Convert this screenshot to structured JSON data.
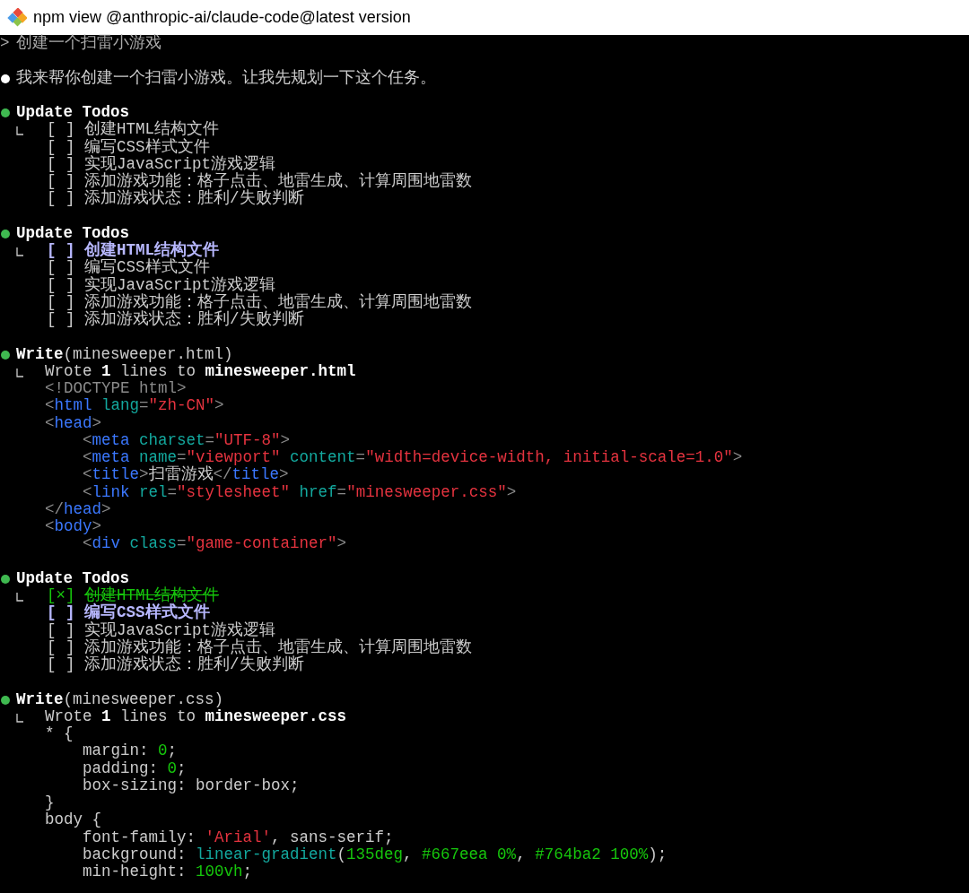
{
  "window": {
    "title": "npm view @anthropic-ai/claude-code@latest version"
  },
  "transcript": [
    {
      "kind": "prompt",
      "marker": ">",
      "text": "创建一个扫雷小游戏"
    },
    {
      "kind": "message",
      "color": "#ffffff",
      "text": "我来帮你创建一个扫雷小游戏。让我先规划一下这个任务。"
    },
    {
      "kind": "todos",
      "color": "#3fb950",
      "title": "Update Todos",
      "items": [
        {
          "box": "[ ]",
          "text": "创建HTML结构文件",
          "checked": false,
          "active": false
        },
        {
          "box": "[ ]",
          "text": "编写CSS样式文件",
          "checked": false,
          "active": false
        },
        {
          "box": "[ ]",
          "text": "实现JavaScript游戏逻辑",
          "checked": false,
          "active": false
        },
        {
          "box": "[ ]",
          "text": "添加游戏功能：格子点击、地雷生成、计算周围地雷数",
          "checked": false,
          "active": false
        },
        {
          "box": "[ ]",
          "text": "添加游戏状态：胜利/失败判断",
          "checked": false,
          "active": false
        }
      ]
    },
    {
      "kind": "todos",
      "color": "#3fb950",
      "title": "Update Todos",
      "items": [
        {
          "box": "[ ]",
          "text": "创建HTML结构文件",
          "checked": false,
          "active": true
        },
        {
          "box": "[ ]",
          "text": "编写CSS样式文件",
          "checked": false,
          "active": false
        },
        {
          "box": "[ ]",
          "text": "实现JavaScript游戏逻辑",
          "checked": false,
          "active": false
        },
        {
          "box": "[ ]",
          "text": "添加游戏功能：格子点击、地雷生成、计算周围地雷数",
          "checked": false,
          "active": false
        },
        {
          "box": "[ ]",
          "text": "添加游戏状态：胜利/失败判断",
          "checked": false,
          "active": false
        }
      ]
    },
    {
      "kind": "tool",
      "color": "#3fb950",
      "header": "**Write**(minesweeper.html)",
      "result": "Wrote **1** lines to **minesweeper.html**",
      "code": [
        {
          "tokens": [
            {
              "kind": "doctype",
              "text": "<!DOCTYPE html>"
            }
          ]
        },
        {
          "tokens": [
            {
              "kind": "punct",
              "text": "<"
            },
            {
              "kind": "tag",
              "text": "html"
            },
            {
              "kind": "attr",
              "text": " lang"
            },
            {
              "kind": "punct",
              "text": "="
            },
            {
              "kind": "string",
              "text": "\"zh-CN\""
            },
            {
              "kind": "punct",
              "text": ">"
            }
          ]
        },
        {
          "tokens": [
            {
              "kind": "punct",
              "text": "<"
            },
            {
              "kind": "tag",
              "text": "head"
            },
            {
              "kind": "punct",
              "text": ">"
            }
          ],
          "children": [
            {
              "tokens": [
                {
                  "kind": "punct",
                  "text": "<"
                },
                {
                  "kind": "tag",
                  "text": "meta"
                },
                {
                  "kind": "attr",
                  "text": " charset"
                },
                {
                  "kind": "punct",
                  "text": "="
                },
                {
                  "kind": "string",
                  "text": "\"UTF-8\""
                },
                {
                  "kind": "punct",
                  "text": ">"
                }
              ]
            },
            {
              "tokens": [
                {
                  "kind": "punct",
                  "text": "<"
                },
                {
                  "kind": "tag",
                  "text": "meta"
                },
                {
                  "kind": "attr",
                  "text": " name"
                },
                {
                  "kind": "punct",
                  "text": "="
                },
                {
                  "kind": "string",
                  "text": "\"viewport\""
                },
                {
                  "kind": "attr",
                  "text": " content"
                },
                {
                  "kind": "punct",
                  "text": "="
                },
                {
                  "kind": "string",
                  "text": "\"width=device-width, initial-scale=1.0\""
                },
                {
                  "kind": "punct",
                  "text": ">"
                }
              ]
            },
            {
              "tokens": [
                {
                  "kind": "punct",
                  "text": "<"
                },
                {
                  "kind": "tag",
                  "text": "title"
                },
                {
                  "kind": "punct",
                  "text": ">"
                },
                {
                  "kind": "plain",
                  "text": "扫雷游戏"
                },
                {
                  "kind": "punct",
                  "text": "</"
                },
                {
                  "kind": "tag",
                  "text": "title"
                },
                {
                  "kind": "punct",
                  "text": ">"
                }
              ]
            },
            {
              "tokens": [
                {
                  "kind": "punct",
                  "text": "<"
                },
                {
                  "kind": "tag",
                  "text": "link"
                },
                {
                  "kind": "attr",
                  "text": " rel"
                },
                {
                  "kind": "punct",
                  "text": "="
                },
                {
                  "kind": "string",
                  "text": "\"stylesheet\""
                },
                {
                  "kind": "attr",
                  "text": " href"
                },
                {
                  "kind": "punct",
                  "text": "="
                },
                {
                  "kind": "string",
                  "text": "\"minesweeper.css\""
                },
                {
                  "kind": "punct",
                  "text": ">"
                }
              ]
            }
          ]
        },
        {
          "tokens": [
            {
              "kind": "punct",
              "text": "</"
            },
            {
              "kind": "tag",
              "text": "head"
            },
            {
              "kind": "punct",
              "text": ">"
            }
          ]
        },
        {
          "tokens": [
            {
              "kind": "punct",
              "text": "<"
            },
            {
              "kind": "tag",
              "text": "body"
            },
            {
              "kind": "punct",
              "text": ">"
            }
          ],
          "children": [
            {
              "tokens": [
                {
                  "kind": "punct",
                  "text": "<"
                },
                {
                  "kind": "tag",
                  "text": "div"
                },
                {
                  "kind": "attr",
                  "text": " class"
                },
                {
                  "kind": "punct",
                  "text": "="
                },
                {
                  "kind": "string",
                  "text": "\"game-container\""
                },
                {
                  "kind": "punct",
                  "text": ">"
                }
              ]
            }
          ]
        }
      ]
    },
    {
      "kind": "todos",
      "color": "#3fb950",
      "title": "Update Todos",
      "items": [
        {
          "box": "[×]",
          "text": "创建HTML结构文件",
          "checked": true,
          "active": false
        },
        {
          "box": "[ ]",
          "text": "编写CSS样式文件",
          "checked": false,
          "active": true
        },
        {
          "box": "[ ]",
          "text": "实现JavaScript游戏逻辑",
          "checked": false,
          "active": false
        },
        {
          "box": "[ ]",
          "text": "添加游戏功能：格子点击、地雷生成、计算周围地雷数",
          "checked": false,
          "active": false
        },
        {
          "box": "[ ]",
          "text": "添加游戏状态：胜利/失败判断",
          "checked": false,
          "active": false
        }
      ]
    },
    {
      "kind": "tool",
      "color": "#3fb950",
      "header": "**Write**(minesweeper.css)",
      "result": "Wrote **1** lines to **minesweeper.css**",
      "code": [
        {
          "tokens": [
            {
              "kind": "plain",
              "text": "* {"
            }
          ],
          "children": [
            {
              "tokens": [
                {
                  "kind": "plain",
                  "text": "margin: "
                },
                {
                  "kind": "number",
                  "text": "0"
                },
                {
                  "kind": "plain",
                  "text": ";"
                }
              ]
            },
            {
              "tokens": [
                {
                  "kind": "plain",
                  "text": "padding: "
                },
                {
                  "kind": "number",
                  "text": "0"
                },
                {
                  "kind": "plain",
                  "text": ";"
                }
              ]
            },
            {
              "tokens": [
                {
                  "kind": "plain",
                  "text": "box-sizing: border-box;"
                }
              ]
            }
          ]
        },
        {
          "tokens": [
            {
              "kind": "plain",
              "text": "}"
            }
          ]
        },
        {
          "tokens": [
            {
              "kind": "plain",
              "text": "body {"
            }
          ],
          "children": [
            {
              "tokens": [
                {
                  "kind": "plain",
                  "text": "font-family: "
                },
                {
                  "kind": "string",
                  "text": "'Arial'"
                },
                {
                  "kind": "plain",
                  "text": ", sans-serif;"
                }
              ]
            },
            {
              "tokens": [
                {
                  "kind": "plain",
                  "text": "background: "
                },
                {
                  "kind": "func",
                  "text": "linear-gradient"
                },
                {
                  "kind": "plain",
                  "text": "("
                },
                {
                  "kind": "number",
                  "text": "135deg"
                },
                {
                  "kind": "plain",
                  "text": ", "
                },
                {
                  "kind": "number",
                  "text": "#667eea 0%"
                },
                {
                  "kind": "plain",
                  "text": ", "
                },
                {
                  "kind": "number",
                  "text": "#764ba2 100%"
                },
                {
                  "kind": "plain",
                  "text": ");"
                }
              ]
            },
            {
              "tokens": [
                {
                  "kind": "plain",
                  "text": "min-height: "
                },
                {
                  "kind": "number",
                  "text": "100vh"
                },
                {
                  "kind": "plain",
                  "text": ";"
                }
              ]
            }
          ]
        }
      ]
    }
  ]
}
